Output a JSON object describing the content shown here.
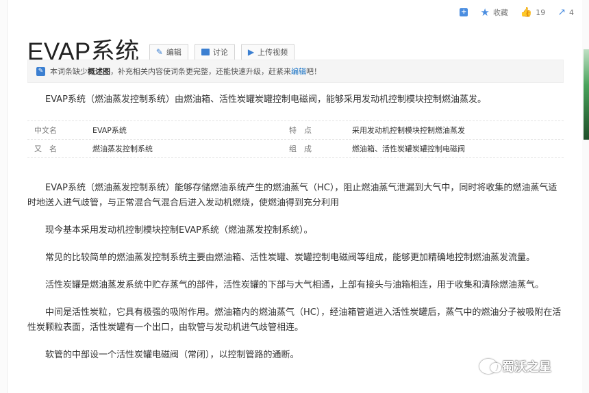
{
  "toolbar": {
    "add_icon_label": "+",
    "collect_label": "收藏",
    "like_count": "19",
    "share_count": "4"
  },
  "header": {
    "title": "EVAP系统",
    "buttons": [
      "编辑",
      "讨论",
      "上传视频"
    ]
  },
  "notice": {
    "pre": "本词条缺少",
    "bold": "概述图",
    "mid": "，补充相关内容使词条更完整，还能快速升级，赶紧来",
    "link": "编辑",
    "post": "吧！"
  },
  "summary": "EVAP系统（燃油蒸发控制系统）由燃油箱、活性炭罐炭罐控制电磁阀，能够采用发动机控制模块控制燃油蒸发。",
  "basic_info": [
    {
      "label": "中文名",
      "value": "EVAP系统",
      "label2": "特　点",
      "value2": "采用发动机控制模块控制燃油蒸发"
    },
    {
      "label": "又　名",
      "value": "燃油蒸发控制系统",
      "label2": "组　成",
      "value2": "燃油箱、活性炭罐炭罐控制电磁阀"
    }
  ],
  "paragraphs": [
    "EVAP系统（燃油蒸发控制系统）能够存储燃油系统产生的燃油蒸气（HC），阻止燃油蒸气泄漏到大气中，同时将收集的燃油蒸气适时地送入进气歧管，与正常混合气混合后进入发动机燃烧，使燃油得到充分利用",
    "现今基本采用发动机控制模块控制EVAP系统（燃油蒸发控制系统）。",
    "常见的比较简单的燃油蒸发控制系统主要由燃油箱、活性炭罐、炭罐控制电磁阀等组成，能够更加精确地控制燃油蒸发流量。",
    "活性炭罐是燃油蒸发系统中贮存蒸气的部件，活性炭罐的下部与大气相通，上部有接头与油箱相连，用于收集和清除燃油蒸气。",
    "中间是活性炭粒，它具有极强的吸附作用。燃油箱内的燃油蒸气（HC），经油箱管道进入活性炭罐后，蒸气中的燃油分子被吸附在活性炭颗粒表面，活性炭罐有一个出口，由软管与发动机进气歧管相连。",
    "软管的中部设一个活性炭罐电磁阀（常闭），以控制管路的通断。"
  ],
  "watermark": "蜀沃之星",
  "colors": {
    "accent": "#3b7fd1",
    "link": "#136ec2",
    "title": "#222222"
  }
}
